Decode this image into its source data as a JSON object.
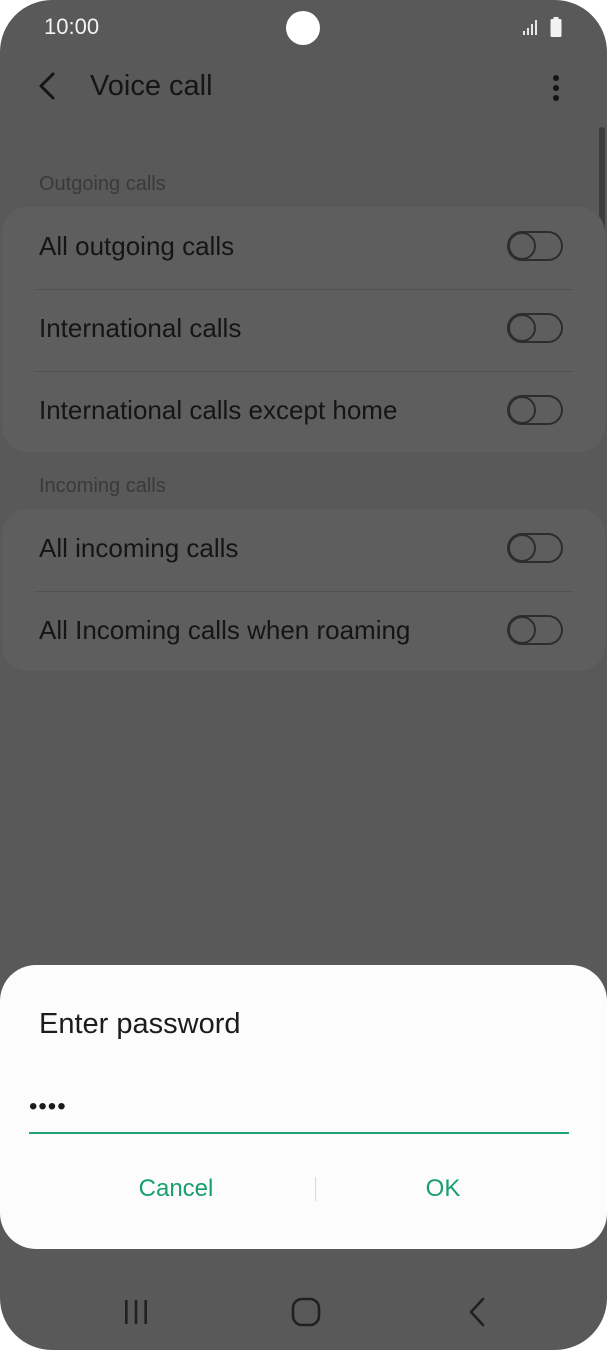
{
  "status_bar": {
    "time": "10:00",
    "icons": [
      "camera-cutout",
      "signal-icon",
      "battery-icon"
    ]
  },
  "app_bar": {
    "title": "Voice call",
    "back_icon": "chevron-left-icon",
    "more_icon": "more-vertical-icon"
  },
  "sections": [
    {
      "label": "Outgoing calls",
      "items": [
        {
          "label": "All outgoing calls",
          "enabled": false
        },
        {
          "label": "International calls",
          "enabled": false
        },
        {
          "label": "International calls except home",
          "enabled": false
        }
      ]
    },
    {
      "label": "Incoming calls",
      "items": [
        {
          "label": "All incoming calls",
          "enabled": false
        },
        {
          "label": "All Incoming calls when roaming",
          "enabled": false
        }
      ]
    }
  ],
  "dialog": {
    "title": "Enter password",
    "password_value": "••••",
    "cancel_label": "Cancel",
    "ok_label": "OK"
  },
  "nav_bar": {
    "icons": [
      "recent-apps-icon",
      "home-icon",
      "back-icon"
    ]
  },
  "colors": {
    "overlay": "#595959",
    "accent": "#17a06d",
    "dialog_bg": "#fcfcfc"
  }
}
